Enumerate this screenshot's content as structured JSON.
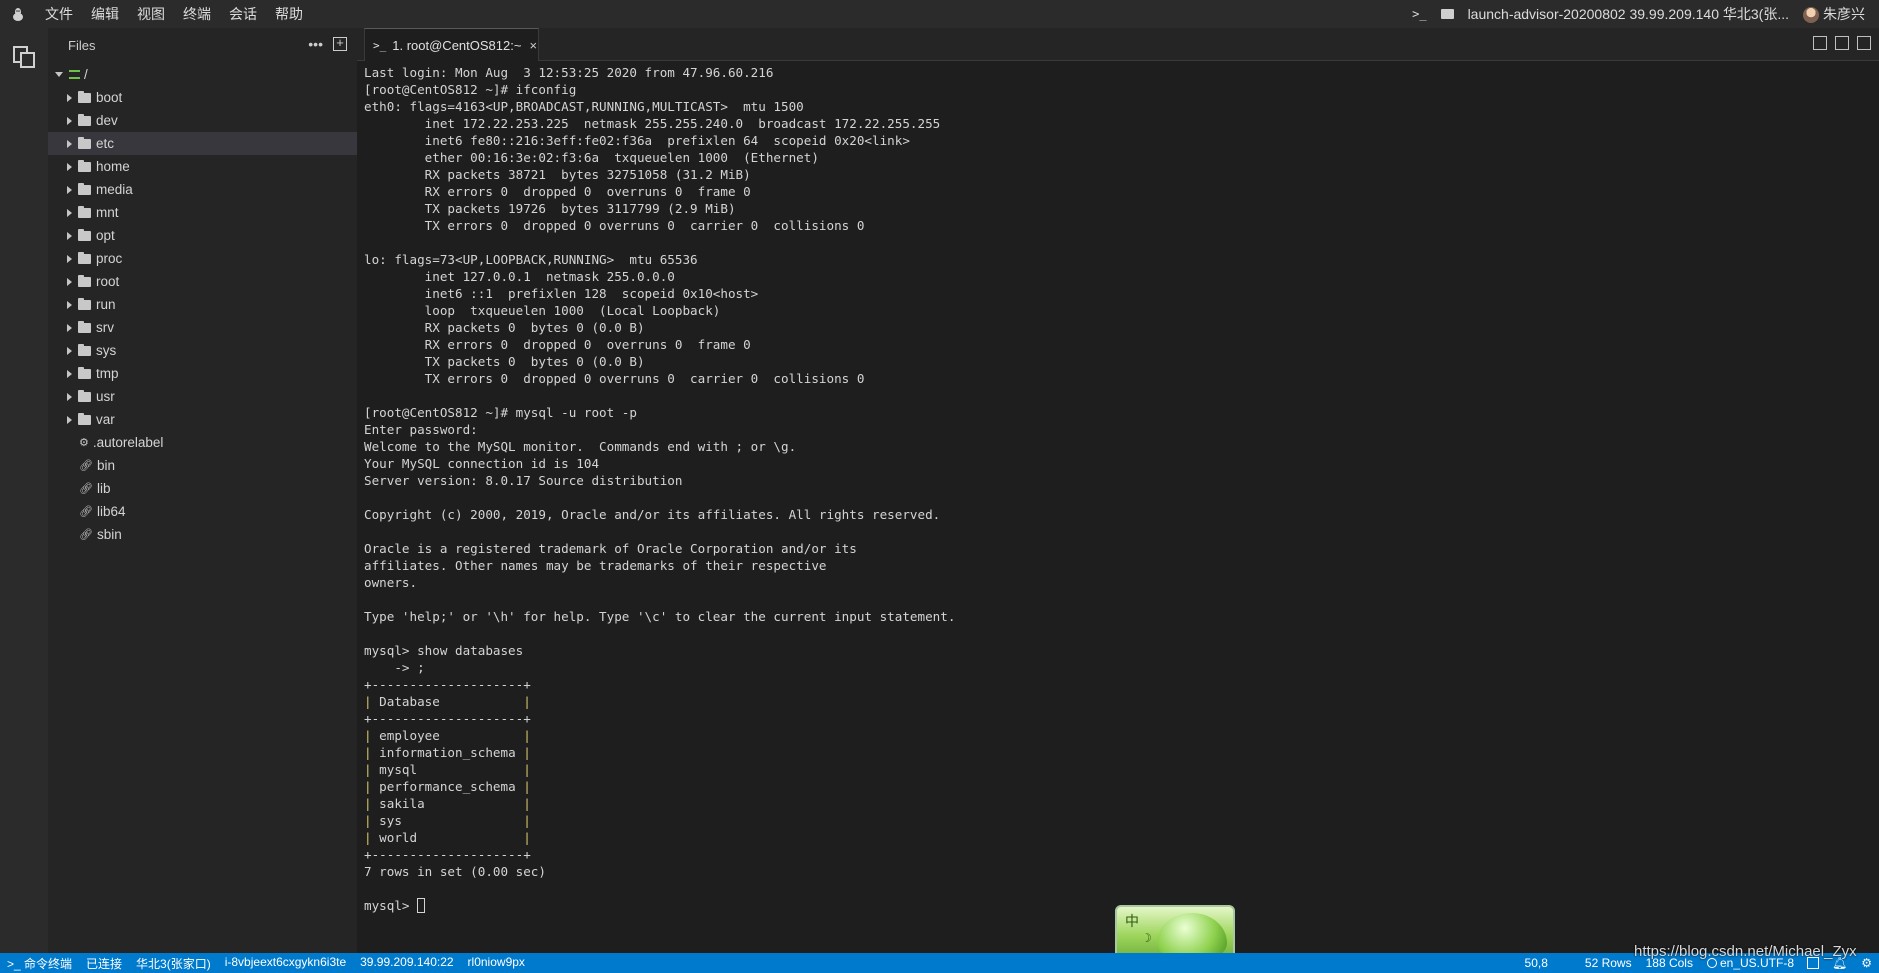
{
  "menubar": {
    "items": [
      "文件",
      "编辑",
      "视图",
      "终端",
      "会话",
      "帮助"
    ],
    "session_prompt": ">_",
    "session_name": "launch-advisor-20200802 39.99.209.140 华北3(张...",
    "user_name": "朱彦兴"
  },
  "sidebar": {
    "title": "Files",
    "root": "/",
    "folders": [
      "boot",
      "dev",
      "etc",
      "home",
      "media",
      "mnt",
      "opt",
      "proc",
      "root",
      "run",
      "srv",
      "sys",
      "tmp",
      "usr",
      "var"
    ],
    "selected": "etc",
    "files": [
      {
        "name": ".autorelabel",
        "icon": "gear-icon"
      },
      {
        "name": "bin",
        "icon": "link-icon"
      },
      {
        "name": "lib",
        "icon": "link-icon"
      },
      {
        "name": "lib64",
        "icon": "link-icon"
      },
      {
        "name": "sbin",
        "icon": "link-icon"
      }
    ]
  },
  "tab": {
    "prompt": ">_",
    "label": "1. root@CentOS812:~",
    "close": "×"
  },
  "terminal": {
    "lines": [
      "Last login: Mon Aug  3 12:53:25 2020 from 47.96.60.216",
      "[root@CentOS812 ~]# ifconfig",
      "eth0: flags=4163<UP,BROADCAST,RUNNING,MULTICAST>  mtu 1500",
      "        inet 172.22.253.225  netmask 255.255.240.0  broadcast 172.22.255.255",
      "        inet6 fe80::216:3eff:fe02:f36a  prefixlen 64  scopeid 0x20<link>",
      "        ether 00:16:3e:02:f3:6a  txqueuelen 1000  (Ethernet)",
      "        RX packets 38721  bytes 32751058 (31.2 MiB)",
      "        RX errors 0  dropped 0  overruns 0  frame 0",
      "        TX packets 19726  bytes 3117799 (2.9 MiB)",
      "        TX errors 0  dropped 0 overruns 0  carrier 0  collisions 0",
      "",
      "lo: flags=73<UP,LOOPBACK,RUNNING>  mtu 65536",
      "        inet 127.0.0.1  netmask 255.0.0.0",
      "        inet6 ::1  prefixlen 128  scopeid 0x10<host>",
      "        loop  txqueuelen 1000  (Local Loopback)",
      "        RX packets 0  bytes 0 (0.0 B)",
      "        RX errors 0  dropped 0  overruns 0  frame 0",
      "        TX packets 0  bytes 0 (0.0 B)",
      "        TX errors 0  dropped 0 overruns 0  carrier 0  collisions 0",
      "",
      "[root@CentOS812 ~]# mysql -u root -p",
      "Enter password:",
      "Welcome to the MySQL monitor.  Commands end with ; or \\g.",
      "Your MySQL connection id is 104",
      "Server version: 8.0.17 Source distribution",
      "",
      "Copyright (c) 2000, 2019, Oracle and/or its affiliates. All rights reserved.",
      "",
      "Oracle is a registered trademark of Oracle Corporation and/or its",
      "affiliates. Other names may be trademarks of their respective",
      "owners.",
      "",
      "Type 'help;' or '\\h' for help. Type '\\c' to clear the current input statement.",
      "",
      "mysql> show databases",
      "    -> ;",
      "+--------------------+",
      "| Database           |",
      "+--------------------+",
      "| employee           |",
      "| information_schema |",
      "| mysql              |",
      "| performance_schema |",
      "| sakila             |",
      "| sys                |",
      "| world              |",
      "+--------------------+",
      "7 rows in set (0.00 sec)",
      ""
    ],
    "prompt": "mysql> "
  },
  "statusbar": {
    "left": [
      {
        "text": ">_ 命令终端",
        "name": "command-terminal-button"
      },
      {
        "text": "已连接",
        "name": "connection-status"
      },
      {
        "text": "华北3(张家口)",
        "name": "region-label"
      },
      {
        "text": "i-8vbjeext6cxgykn6i3te",
        "name": "instance-id"
      },
      {
        "text": "39.99.209.140:22",
        "name": "host-address"
      },
      {
        "text": "rl0niow9px",
        "name": "session-id"
      }
    ],
    "cursor_pos": "50,8",
    "rows": "52 Rows",
    "cols": "188 Cols",
    "encoding": "en_US.UTF-8"
  },
  "ime": {
    "char": "中",
    "moon": "☽",
    "gear": "⚙",
    "help": "?"
  },
  "watermark": "https://blog.csdn.net/Michael_Zyx"
}
